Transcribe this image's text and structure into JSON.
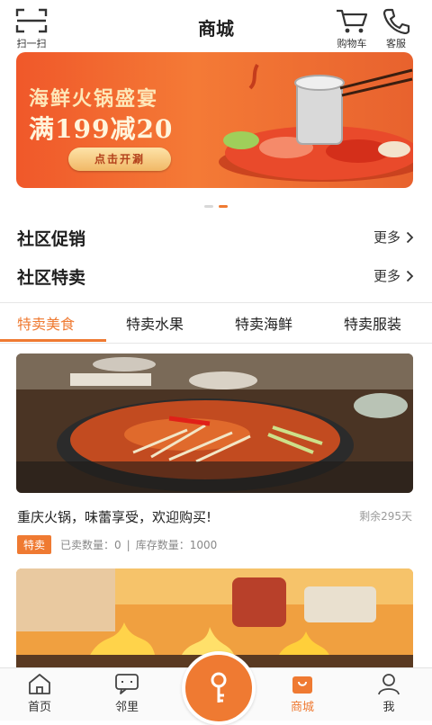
{
  "header": {
    "title": "商城",
    "scan_label": "扫一扫",
    "cart_label": "购物车",
    "service_label": "客服"
  },
  "banner": {
    "title": "海鲜火锅盛宴",
    "promo": "满199减20",
    "button": "点击开涮"
  },
  "carousel": {
    "count": 2,
    "active_index": 1
  },
  "sections": [
    {
      "title": "社区促销",
      "more": "更多"
    },
    {
      "title": "社区特卖",
      "more": "更多"
    }
  ],
  "tabs": [
    {
      "label": "特卖美食",
      "active": true
    },
    {
      "label": "特卖水果",
      "active": false
    },
    {
      "label": "特卖海鲜",
      "active": false
    },
    {
      "label": "特卖服装",
      "active": false
    }
  ],
  "products": [
    {
      "title": "重庆火锅，味蕾享受，欢迎购买!",
      "remaining": "剩余295天",
      "badge": "特卖",
      "sold": "已卖数量：0",
      "separator": "|",
      "stock": "库存数量：1000"
    }
  ],
  "bottom_nav": [
    {
      "label": "首页",
      "icon": "home-icon"
    },
    {
      "label": "邻里",
      "icon": "chat-icon"
    },
    {
      "label": "",
      "icon": "key-icon"
    },
    {
      "label": "商城",
      "icon": "shop-bag-icon",
      "active": true
    },
    {
      "label": "我",
      "icon": "user-icon"
    }
  ],
  "colors": {
    "accent": "#ef7a32",
    "banner": "#f0582a",
    "text": "#222222"
  }
}
